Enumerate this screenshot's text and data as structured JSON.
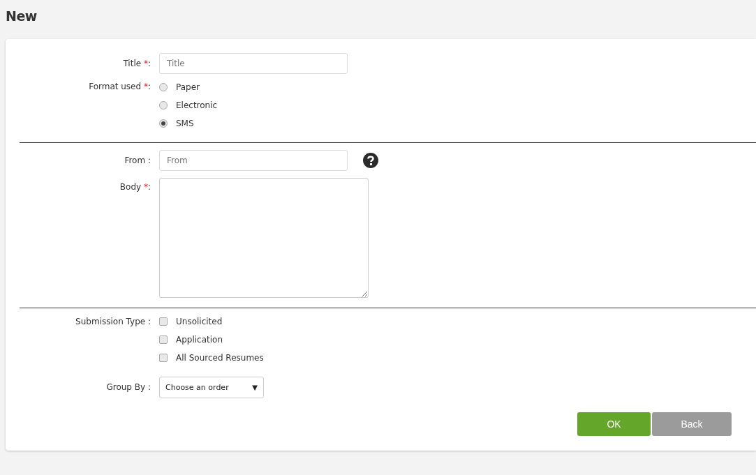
{
  "page": {
    "title": "New"
  },
  "title_field": {
    "label": "Title",
    "mark": "*",
    "suffix": ":",
    "placeholder": "Title"
  },
  "format": {
    "label": "Format used",
    "mark": "*",
    "suffix": ":",
    "options": [
      {
        "label": "Paper",
        "selected": false
      },
      {
        "label": "Electronic",
        "selected": false
      },
      {
        "label": "SMS",
        "selected": true
      }
    ]
  },
  "from_field": {
    "label": "From :",
    "placeholder": "From"
  },
  "body_field": {
    "label": "Body",
    "mark": "*",
    "suffix": ":"
  },
  "submission_type": {
    "label": "Submission Type :",
    "options": [
      {
        "label": "Unsolicited",
        "checked": false
      },
      {
        "label": "Application",
        "checked": false
      },
      {
        "label": "All Sourced Resumes",
        "checked": false
      }
    ]
  },
  "group_by": {
    "label": "Group By :",
    "value": "Choose an order",
    "caret": "▼"
  },
  "buttons": [
    {
      "label": "OK",
      "kind": "primary"
    },
    {
      "label": "Back",
      "kind": "secondary"
    }
  ]
}
